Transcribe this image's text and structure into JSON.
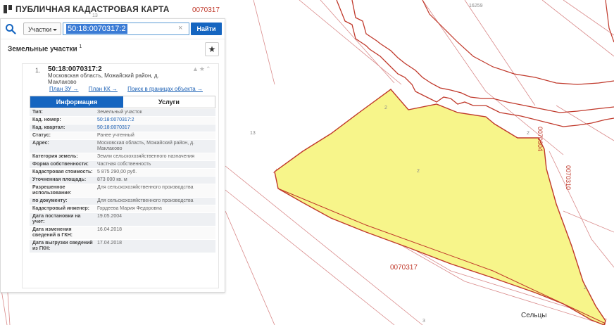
{
  "app": {
    "title": "ПУБЛИЧНАЯ КАДАСТРОВАЯ КАРТА"
  },
  "search": {
    "type_label": "Участки",
    "query": "50:18:0070317:2",
    "clear_glyph": "×",
    "button_label": "Найти"
  },
  "results": {
    "section_title": "Земельные участки",
    "count": "1",
    "star_glyph": "★",
    "items": [
      {
        "num": "1.",
        "cad_id": "50:18:0070317:2",
        "address": "Московская область, Можайский район, д. Маклаково",
        "tools": "▲★⌃",
        "links": [
          "План ЗУ →",
          "План КК →",
          "Поиск в границах объекта →"
        ]
      }
    ]
  },
  "tabs": {
    "info": "Информация",
    "services": "Услуги"
  },
  "properties": [
    {
      "label": "Тип:",
      "value": "Земельный участок"
    },
    {
      "label": "Кад. номер:",
      "value": "50:18:0070317:2"
    },
    {
      "label": "Кад. квартал:",
      "value": "50:18:0070317"
    },
    {
      "label": "Статус:",
      "value": "Ранее учтенный"
    },
    {
      "label": "Адрес:",
      "value": "Московская область, Можайский район, д. Маклаково"
    },
    {
      "label": "Категория земель:",
      "value": "Земли сельскохозяйственного назначения"
    },
    {
      "label": "Форма собственности:",
      "value": "Частная собственность"
    },
    {
      "label": "Кадастровая стоимость:",
      "value": "5 875 290,00 руб."
    },
    {
      "label": "Уточненная площадь:",
      "value": "873 000 кв. м"
    },
    {
      "label": "Разрешенное использование:",
      "value": "Для сельскохозяйственного производства"
    },
    {
      "label": "по документу:",
      "value": "Для сельскохозяйственного производства"
    },
    {
      "label": "Кадастровый инженер:",
      "value": "Гордеева Мария Федоровна"
    },
    {
      "label": "Дата постановки на учет:",
      "value": "19.05.2004"
    },
    {
      "label": "Дата изменения сведений в ГКН:",
      "value": "16.04.2018"
    },
    {
      "label": "Дата выгрузки сведений из ГКН:",
      "value": "17.04.2018"
    }
  ],
  "map_labels": {
    "quarter_top": "0070317",
    "num_13_top": "13",
    "num_16259": "16259",
    "num_13_left": "13",
    "quarter_0070304": "0070304",
    "quarter_0070310": "0070310",
    "quarter_bottom": "0070317",
    "village": "Сельцы",
    "parcel_2a": "2",
    "parcel_2b": "2",
    "parcel_2c": "2",
    "parcel_2d": "2",
    "num_3": "3"
  },
  "colors": {
    "parcel_fill": "#f7f58a",
    "parcel_stroke": "#c0392b",
    "accent": "#1565c0"
  }
}
